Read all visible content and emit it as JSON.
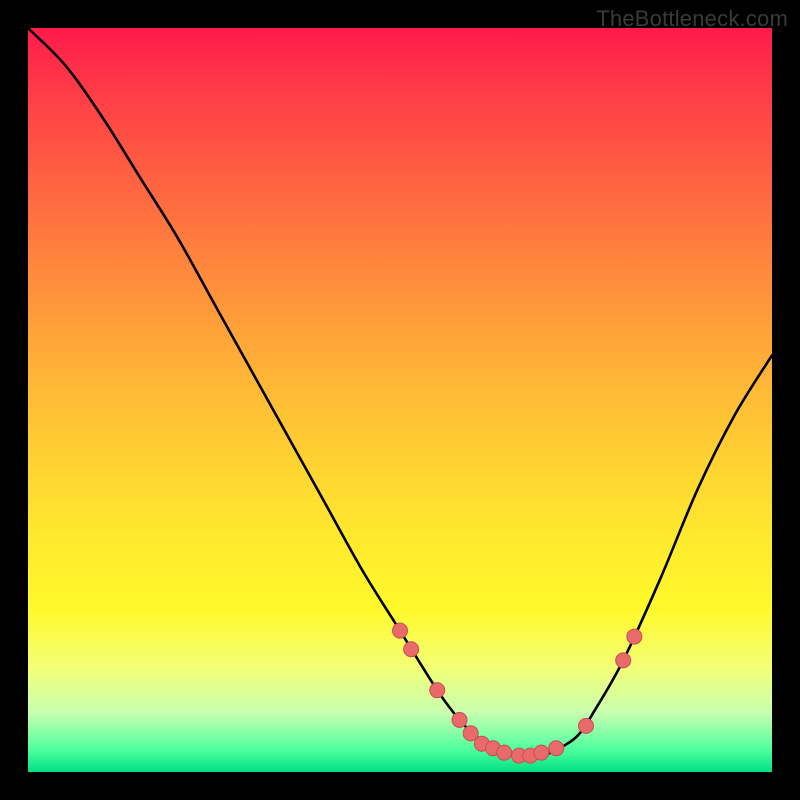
{
  "watermark": "TheBottleneck.com",
  "colors": {
    "frame": "#000000",
    "curve": "#000000",
    "marker_fill": "#e86a6a",
    "marker_stroke": "#c94f4f"
  },
  "chart_data": {
    "type": "line",
    "title": "",
    "xlabel": "",
    "ylabel": "",
    "xlim": [
      0,
      100
    ],
    "ylim": [
      0,
      100
    ],
    "grid": false,
    "legend": false,
    "series": [
      {
        "name": "bottleneck_curve",
        "x": [
          0,
          5,
          10,
          15,
          20,
          25,
          30,
          35,
          40,
          45,
          50,
          55,
          58,
          60,
          62,
          64,
          66,
          68,
          70,
          72,
          74,
          76,
          80,
          85,
          90,
          95,
          100
        ],
        "y": [
          100,
          95,
          88,
          80,
          72,
          63,
          54,
          45,
          36,
          27,
          19,
          11,
          7,
          5,
          3.5,
          2.5,
          2,
          2,
          2.5,
          3.5,
          5,
          8,
          15,
          26,
          38,
          48,
          56
        ]
      }
    ],
    "markers": [
      {
        "x": 50.0,
        "y": 19.0
      },
      {
        "x": 51.5,
        "y": 16.5
      },
      {
        "x": 55.0,
        "y": 11.0
      },
      {
        "x": 58.0,
        "y": 7.0
      },
      {
        "x": 59.5,
        "y": 5.2
      },
      {
        "x": 61.0,
        "y": 3.8
      },
      {
        "x": 62.5,
        "y": 3.2
      },
      {
        "x": 64.0,
        "y": 2.6
      },
      {
        "x": 66.0,
        "y": 2.2
      },
      {
        "x": 67.5,
        "y": 2.2
      },
      {
        "x": 69.0,
        "y": 2.6
      },
      {
        "x": 71.0,
        "y": 3.2
      },
      {
        "x": 75.0,
        "y": 6.2
      },
      {
        "x": 80.0,
        "y": 15.0
      },
      {
        "x": 81.5,
        "y": 18.2
      }
    ]
  }
}
